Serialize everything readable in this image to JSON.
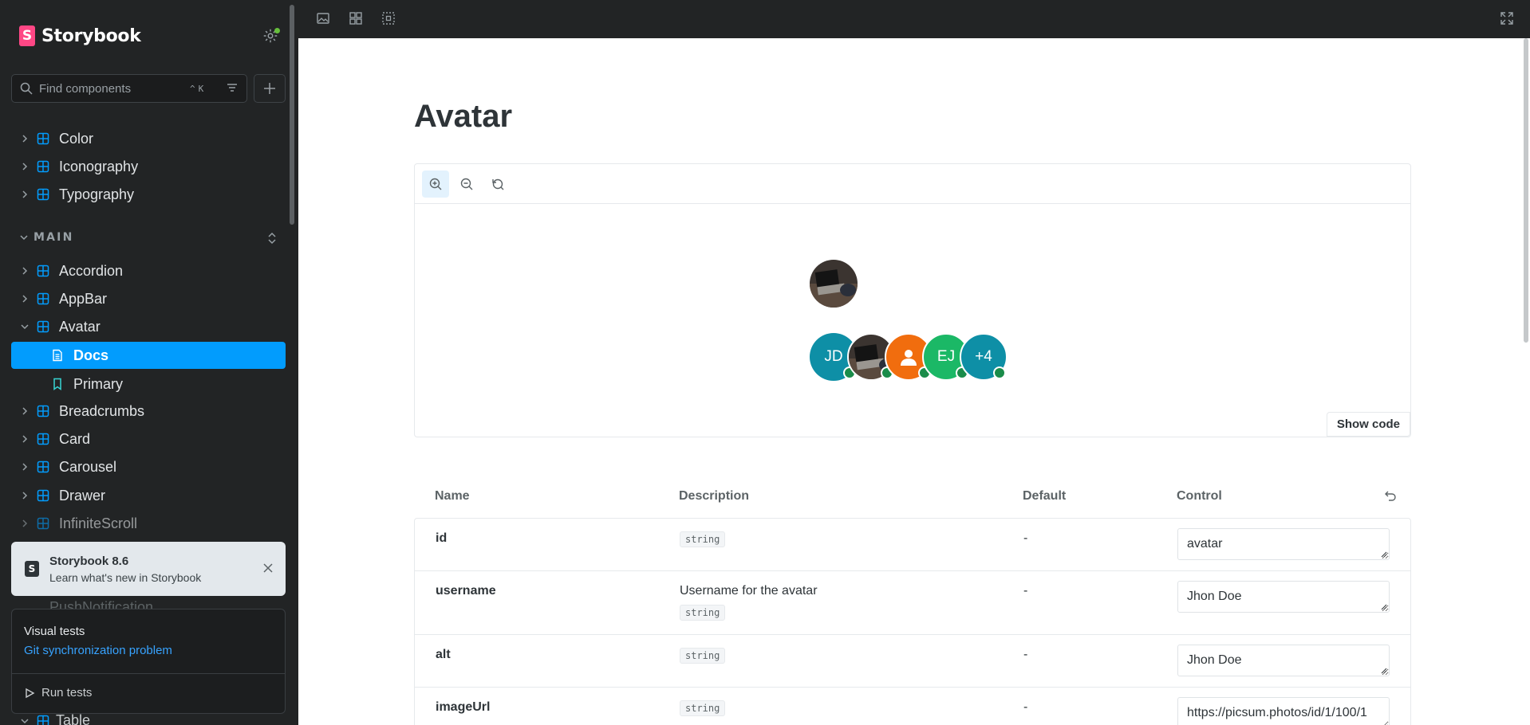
{
  "app": {
    "name": "Storybook",
    "logo_letter": "S"
  },
  "search": {
    "placeholder": "Find components",
    "shortcut_1": "^",
    "shortcut_2": "K"
  },
  "sidebar": {
    "top_items": [
      {
        "label": "Color"
      },
      {
        "label": "Iconography"
      },
      {
        "label": "Typography"
      }
    ],
    "section_label": "MAIN",
    "main_items": [
      {
        "label": "Accordion"
      },
      {
        "label": "AppBar"
      },
      {
        "label": "Avatar"
      },
      {
        "label": "Docs"
      },
      {
        "label": "Primary"
      },
      {
        "label": "Breadcrumbs"
      },
      {
        "label": "Card"
      },
      {
        "label": "Carousel"
      },
      {
        "label": "Drawer"
      },
      {
        "label": "InfiniteScroll"
      }
    ],
    "hidden_item": "PushNotification",
    "table_item": "Table"
  },
  "notification": {
    "title": "Storybook 8.6",
    "subtitle": "Learn what's new in Storybook"
  },
  "test_panel": {
    "title": "Visual tests",
    "link": "Git synchronization problem",
    "run_label": "Run tests"
  },
  "page": {
    "title": "Avatar"
  },
  "preview": {
    "show_code": "Show code",
    "group": [
      {
        "initials": "JD",
        "color": "#0e8fa6"
      },
      {
        "initials": "",
        "color": "#3a3a3a"
      },
      {
        "initials": "",
        "color": "#f16d0e"
      },
      {
        "initials": "EJ",
        "color": "#1bb866"
      },
      {
        "initials": "+4",
        "color": "#0e8fa6"
      }
    ]
  },
  "args_table": {
    "headers": {
      "name": "Name",
      "description": "Description",
      "default": "Default",
      "control": "Control"
    },
    "rows": [
      {
        "name": "id",
        "description": "",
        "type": "string",
        "default": "-",
        "control": "avatar"
      },
      {
        "name": "username",
        "description": "Username for the avatar",
        "type": "string",
        "default": "-",
        "control": "Jhon Doe"
      },
      {
        "name": "alt",
        "description": "",
        "type": "string",
        "default": "-",
        "control": "Jhon Doe"
      },
      {
        "name": "imageUrl",
        "description": "",
        "type": "string",
        "default": "-",
        "control": "https://picsum.photos/id/1/100/1"
      }
    ]
  },
  "colors": {
    "accent": "#029cfd",
    "brand": "#ff4785",
    "link": "#37a3ff",
    "status_online": "#1a8c4a"
  }
}
